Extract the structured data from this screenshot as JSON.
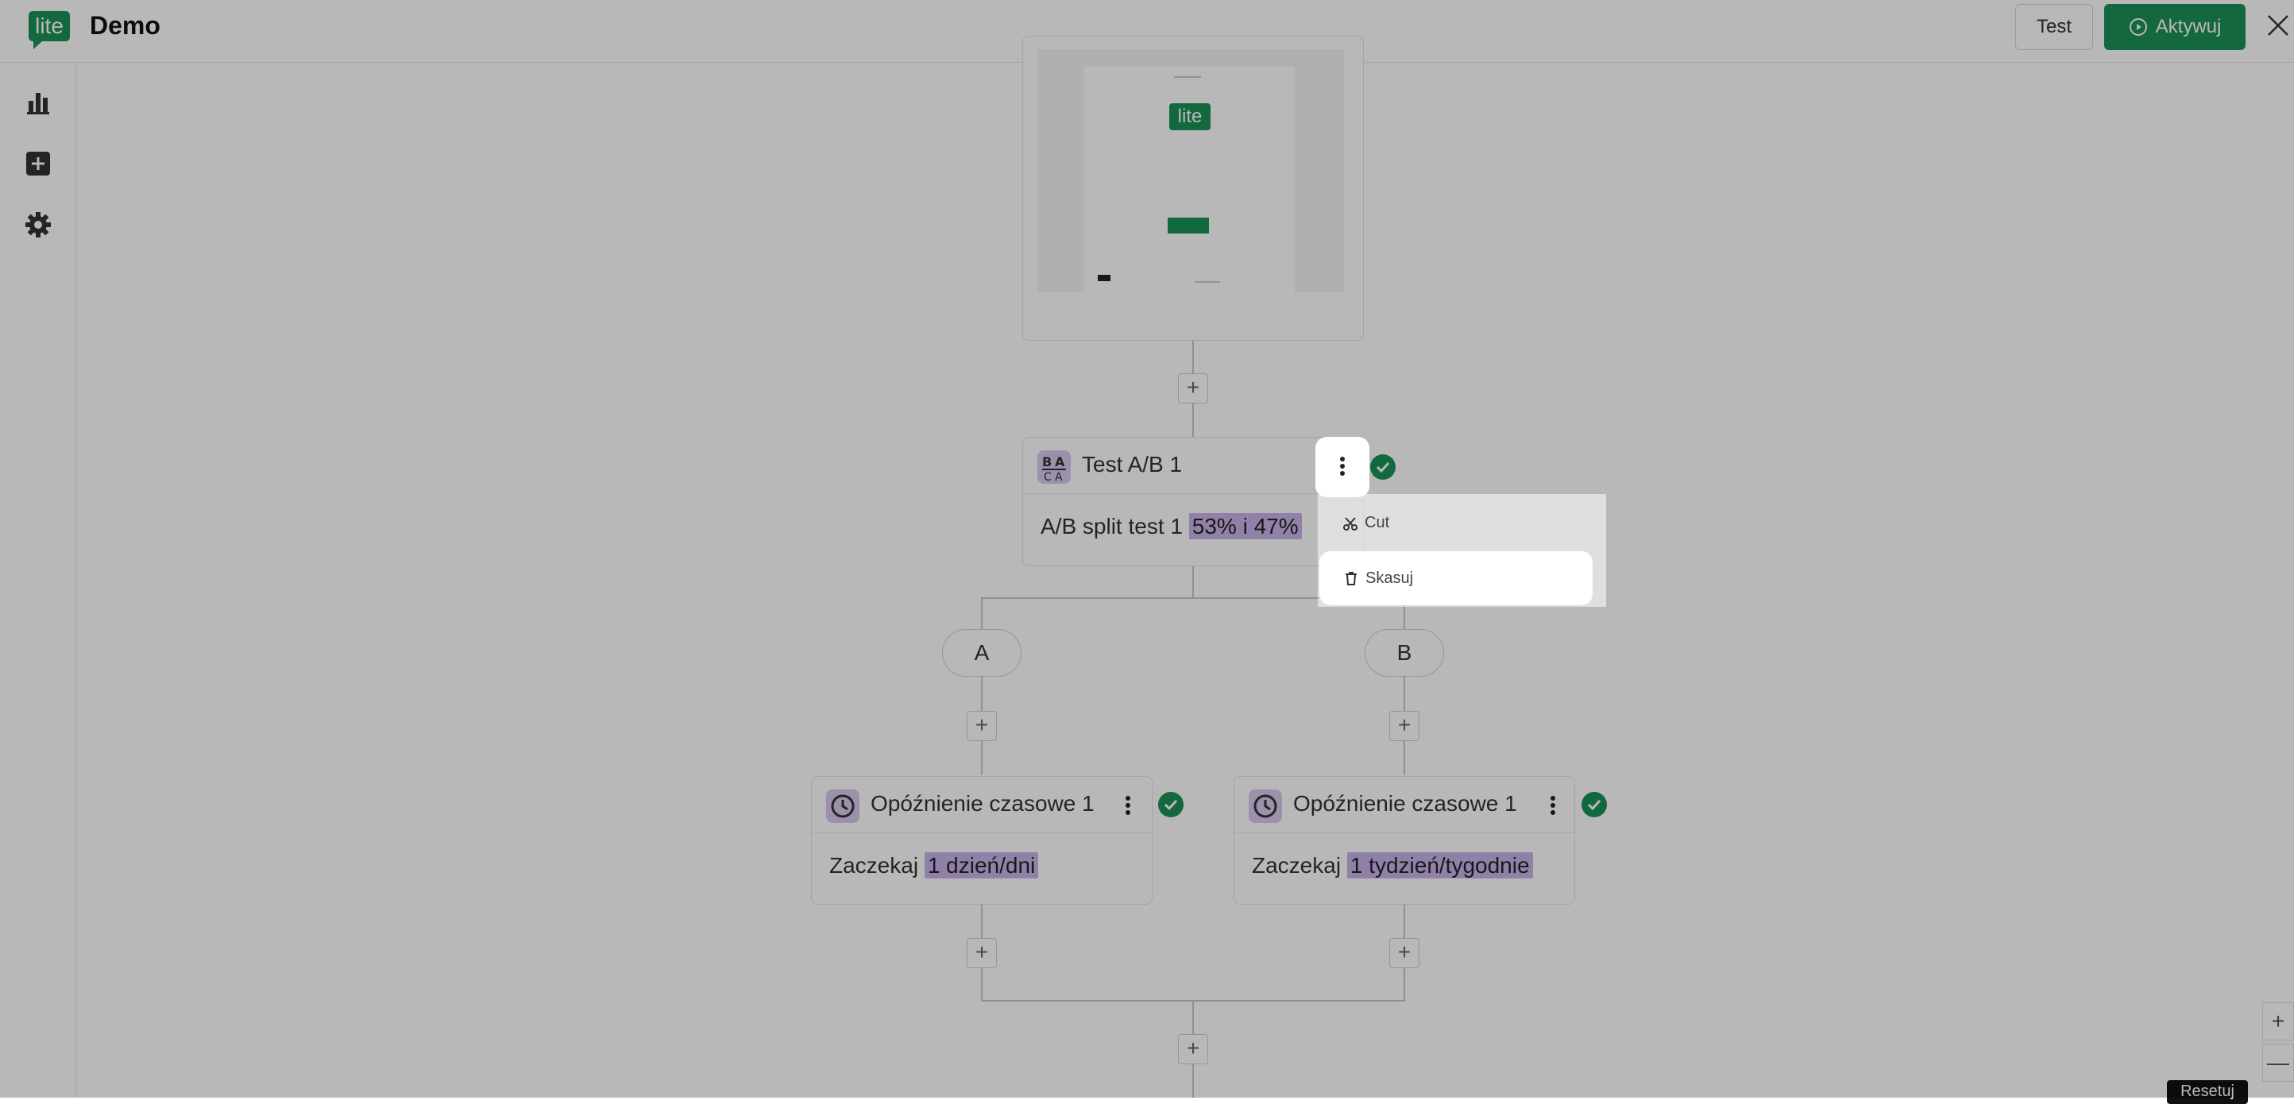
{
  "app": {
    "logo": "lite",
    "title": "Demo"
  },
  "header": {
    "test_label": "Test",
    "activate_label": "Aktywuj"
  },
  "sidebar": {
    "items": [
      {
        "name": "stats",
        "icon": "bar-chart-icon"
      },
      {
        "name": "add",
        "icon": "plus-square-icon"
      },
      {
        "name": "settings",
        "icon": "gear-icon"
      }
    ]
  },
  "preview": {
    "logo": "lite"
  },
  "ab_test": {
    "title": "Test A/B 1",
    "body_label": "A/B split test 1",
    "split": "53% i 47%"
  },
  "branches": {
    "a_label": "A",
    "b_label": "B"
  },
  "delay_a": {
    "title": "Opóźnienie czasowe 1",
    "body_label": "Zaczekaj",
    "value": "1 dzień/dni"
  },
  "delay_b": {
    "title": "Opóźnienie czasowe 1",
    "body_label": "Zaczekaj",
    "value": "1 tydzień/tygodnie"
  },
  "context_menu": {
    "cut_label": "Cut",
    "delete_label": "Skasuj"
  },
  "zoom": {
    "in_label": "+",
    "out_label": "—",
    "reset_label": "Resetuj"
  },
  "colors": {
    "brand_green": "#1c9157",
    "highlight_purple": "#c9b3ea",
    "overlay": "rgba(0,0,0,0.28)"
  }
}
